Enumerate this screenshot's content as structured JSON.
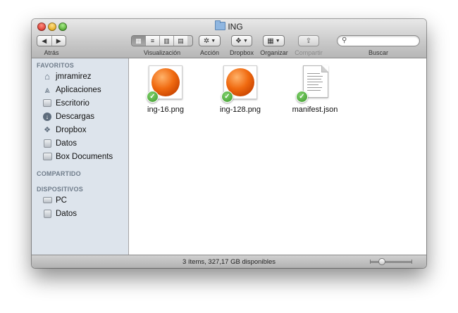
{
  "window": {
    "title": "ING"
  },
  "toolbar": {
    "back": "◀",
    "forward": "▶",
    "back_label": "Atrás",
    "view_label": "Visualización",
    "action_label": "Acción",
    "dropbox_label": "Dropbox",
    "arrange_label": "Organizar",
    "share_label": "Compartir",
    "search_label": "Buscar",
    "search_placeholder": "",
    "view_modes": [
      "icons",
      "list",
      "columns",
      "cover-flow"
    ],
    "active_view": "icons"
  },
  "sidebar": {
    "favorites_header": "FAVORITOS",
    "favorites": [
      {
        "label": "jmramirez",
        "icon": "home-icon"
      },
      {
        "label": "Aplicaciones",
        "icon": "applications-icon"
      },
      {
        "label": "Escritorio",
        "icon": "desktop-icon"
      },
      {
        "label": "Descargas",
        "icon": "downloads-icon"
      },
      {
        "label": "Dropbox",
        "icon": "dropbox-icon"
      },
      {
        "label": "Datos",
        "icon": "drive-icon"
      },
      {
        "label": "Box Documents",
        "icon": "folder-icon"
      }
    ],
    "shared_header": "COMPARTIDO",
    "devices_header": "DISPOSITIVOS",
    "devices": [
      {
        "label": "PC",
        "icon": "computer-icon"
      },
      {
        "label": "Datos",
        "icon": "drive-icon"
      }
    ]
  },
  "files": [
    {
      "name": "ing-16.png",
      "type": "image",
      "synced": true
    },
    {
      "name": "ing-128.png",
      "type": "image",
      "synced": true
    },
    {
      "name": "manifest.json",
      "type": "document",
      "synced": true
    }
  ],
  "status": {
    "text": "3 ítems, 327,17 GB disponibles"
  },
  "colors": {
    "sidebar_bg": "#dde4ec",
    "sync_badge": "#3d9a2d",
    "orb": "#f06a10"
  }
}
